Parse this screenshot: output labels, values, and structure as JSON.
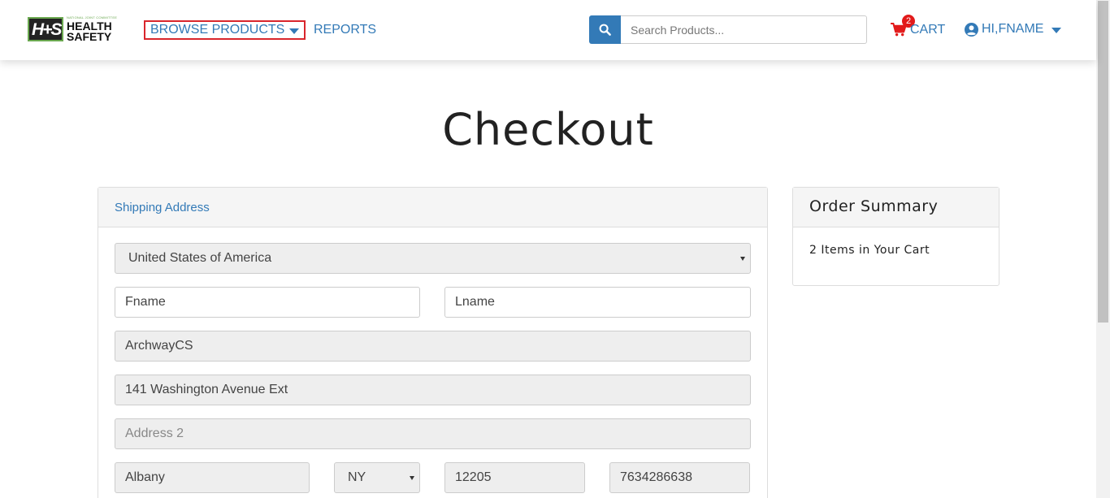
{
  "header": {
    "logo": {
      "small_text": "NATIONAL JOINT COMMITTEE",
      "line1": "HEALTH",
      "line2": "SAFETY",
      "monogram": "H+S"
    },
    "nav": {
      "browse_label": "BROWSE PRODUCTS",
      "reports_label": "REPORTS"
    },
    "search": {
      "placeholder": "Search Products...",
      "icon": "search-icon"
    },
    "cart": {
      "label": "CART",
      "count": "2",
      "icon": "shopping-cart-icon"
    },
    "user": {
      "label": "HI,FNAME",
      "icon": "user-circle-icon"
    }
  },
  "page": {
    "title": "Checkout"
  },
  "shipping": {
    "heading": "Shipping Address",
    "country": "United States of America",
    "first_name": "Fname",
    "last_name": "Lname",
    "company": "ArchwayCS",
    "address1": "141 Washington Avenue Ext",
    "address2_placeholder": "Address 2",
    "city": "Albany",
    "state": "NY",
    "zip": "12205",
    "phone": "7634286638"
  },
  "summary": {
    "heading": "Order Summary",
    "items_text": "2 Items in Your Cart"
  },
  "colors": {
    "link": "#337ab7",
    "accent_red": "#d9262c",
    "badge": "#e21a1a",
    "logo_green": "#6aa84f"
  }
}
